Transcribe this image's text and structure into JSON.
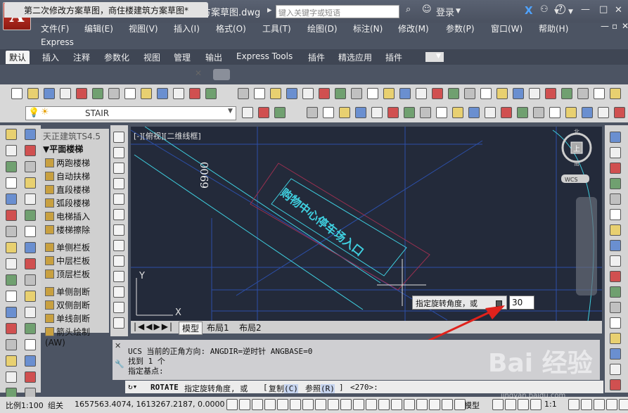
{
  "titlebar": {
    "doc_title": "第二次修改方案草图，商住楼建筑方案草图.dwg",
    "search_placeholder": "键入关键字或短语",
    "login": "登录",
    "help": "?"
  },
  "menus": [
    "文件(F)",
    "编辑(E)",
    "视图(V)",
    "插入(I)",
    "格式(O)",
    "工具(T)",
    "绘图(D)",
    "标注(N)",
    "修改(M)",
    "参数(P)",
    "窗口(W)",
    "帮助(H)",
    "Express"
  ],
  "ribbon_tabs": [
    "默认",
    "插入",
    "注释",
    "参数化",
    "视图",
    "管理",
    "输出",
    "Express Tools",
    "插件",
    "精选应用",
    "插件"
  ],
  "doc_tab": "第二次修改方案草图，商住楼建筑方案草图*",
  "layer": "STAIR",
  "palette": {
    "title": "天正建筑TS4.5",
    "section": "平面楼梯",
    "items": [
      "两跑楼梯",
      "自动扶梯",
      "直段楼梯",
      "弧段楼梯",
      "电梯插入",
      "楼梯擦除",
      "单侧栏板",
      "中层栏板",
      "顶层栏板",
      "单侧剖断",
      "双侧剖断",
      "单线剖断",
      "箭头绘制(AW)"
    ]
  },
  "canvas": {
    "viewport_label": "[-][俯视][二维线框]",
    "dimension_text": "6900",
    "rotated_label": "购物中心停车场入口",
    "ucs_y": "Y",
    "ucs_x": "X",
    "viewcube_top": "上",
    "viewcube_n": "北",
    "viewcube_s": "南",
    "viewcube_wcs": "WCS"
  },
  "layout_tabs": [
    "模型",
    "布局1",
    "布局2"
  ],
  "dynamic_input": {
    "prompt": "指定旋转角度，或",
    "value": "30"
  },
  "command_history": [
    "UCS 当前的正角方向:  ANGDIR=逆时针  ANGBASE=0",
    "找到 1 个",
    "指定基点:"
  ],
  "command_line": {
    "cmd": "ROTATE",
    "prompt": "指定旋转角度, 或",
    "opt1": "复制",
    "opt1_key": "(C)",
    "opt2": "参照",
    "opt2_key": "(R)",
    "default": "<270>:"
  },
  "statusbar": {
    "scale": "比例1:100",
    "group": "组关",
    "coords": "1657563.4074, 1613267.2187, 0.0000",
    "model": "模型",
    "annotation_scale": "1:1"
  },
  "watermark": {
    "brand": "Bai 经验",
    "url": "jingyan.baidu.com"
  },
  "colors": {
    "canvas_bg": "#232a3a",
    "cyan_lines": "#3fd0e0",
    "blue_lines": "#2c4fa8",
    "magenta_box": "#9a3050",
    "arrow": "#e0221c",
    "chrome": "#4c5463"
  }
}
